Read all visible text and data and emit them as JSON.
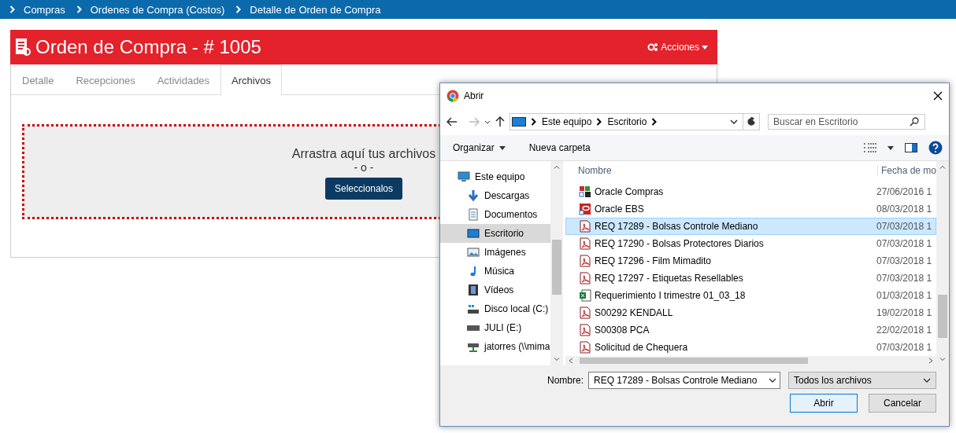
{
  "breadcrumbs": [
    "Compras",
    "Ordenes de Compra (Costos)",
    "Detalle de Orden de Compra"
  ],
  "order": {
    "title": "Orden de Compra - # 1005",
    "actions": "Acciones"
  },
  "tabs": [
    {
      "label": "Detalle",
      "selected": false
    },
    {
      "label": "Recepciones",
      "selected": false
    },
    {
      "label": "Actividades",
      "selected": false
    },
    {
      "label": "Archivos",
      "selected": true
    }
  ],
  "dropzone": {
    "prompt": "Arrastra aquí tus archivos",
    "separator": "- o -",
    "button": "Seleccionalos"
  },
  "dialog": {
    "title": "Abrir",
    "path": [
      "Este equipo",
      "Escritorio"
    ],
    "search": {
      "placeholder": "Buscar en Escritorio"
    },
    "toolbar": {
      "organize": "Organizar",
      "new_folder": "Nueva carpeta"
    },
    "nav_items": [
      {
        "label": "Este equipo",
        "kind": "computer",
        "selected": false
      },
      {
        "label": "Descargas",
        "kind": "download",
        "selected": false
      },
      {
        "label": "Documentos",
        "kind": "documents",
        "selected": false
      },
      {
        "label": "Escritorio",
        "kind": "desktop",
        "selected": true
      },
      {
        "label": "Imágenes",
        "kind": "pictures",
        "selected": false
      },
      {
        "label": "Música",
        "kind": "music",
        "selected": false
      },
      {
        "label": "Vídeos",
        "kind": "videos",
        "selected": false
      },
      {
        "label": "Disco local (C:)",
        "kind": "disk",
        "selected": false
      },
      {
        "label": "JULI (E:)",
        "kind": "drive",
        "selected": false
      },
      {
        "label": "jatorres (\\\\mima",
        "kind": "network",
        "selected": false
      }
    ],
    "columns": [
      "Nombre",
      "Fecha de mo"
    ],
    "files": [
      {
        "name": "Oracle Compras",
        "date": "27/06/2016 1",
        "kind": "app",
        "selected": false
      },
      {
        "name": "Oracle EBS",
        "date": "08/03/2018 1",
        "kind": "link",
        "selected": false
      },
      {
        "name": "REQ 17289 - Bolsas Controle Mediano",
        "date": "07/03/2018 1",
        "kind": "pdf",
        "selected": true
      },
      {
        "name": "REQ 17290 - Bolsas Protectores Diarios",
        "date": "07/03/2018 1",
        "kind": "pdf",
        "selected": false
      },
      {
        "name": "REQ 17296 - Film Mimadito",
        "date": "07/03/2018 1",
        "kind": "pdf",
        "selected": false
      },
      {
        "name": "REQ 17297 - Etiquetas Resellables",
        "date": "07/03/2018 1",
        "kind": "pdf",
        "selected": false
      },
      {
        "name": "Requerimiento I trimestre 01_03_18",
        "date": "01/03/2018 1",
        "kind": "excel",
        "selected": false
      },
      {
        "name": "S00292 KENDALL",
        "date": "19/02/2018 1",
        "kind": "pdf",
        "selected": false
      },
      {
        "name": "S00308 PCA",
        "date": "22/02/2018 1",
        "kind": "pdf",
        "selected": false
      },
      {
        "name": "Solicitud de Chequera",
        "date": "07/03/2018 1",
        "kind": "pdf",
        "selected": false
      }
    ],
    "filename": {
      "label": "Nombre:",
      "value": "REQ 17289 - Bolsas Controle Mediano"
    },
    "filetype": "Todos los archivos",
    "buttons": [
      "Abrir",
      "Cancelar"
    ]
  }
}
